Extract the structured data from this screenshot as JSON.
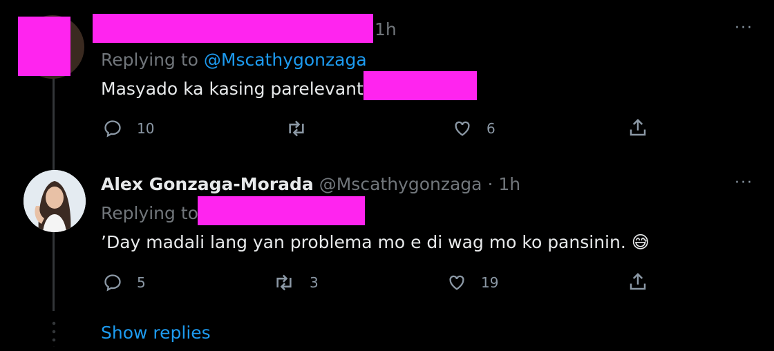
{
  "tweets": [
    {
      "time": "1h",
      "replying_prefix": "Replying to ",
      "replying_handle": "@Mscathygonzaga",
      "text": "Masyado ka kasing parelevant",
      "actions": {
        "reply_count": "10",
        "retweet_count": "",
        "like_count": "6"
      }
    },
    {
      "display_name": "Alex Gonzaga-Morada",
      "handle": "@Mscathygonzaga",
      "separator": "·",
      "time": "1h",
      "replying_prefix": "Replying to",
      "text": "’Day madali lang yan problema mo e di wag mo ko pansinin.",
      "emoji": "😅",
      "actions": {
        "reply_count": "5",
        "retweet_count": "3",
        "like_count": "19"
      }
    }
  ],
  "show_replies": "Show replies",
  "more_label": "···",
  "icons": [
    "reply-icon",
    "retweet-icon",
    "like-icon",
    "share-icon",
    "more-icon"
  ],
  "colors": {
    "background": "#000000",
    "link": "#1d9bf0",
    "redaction": "#ff24ef",
    "muted": "#71767b"
  }
}
